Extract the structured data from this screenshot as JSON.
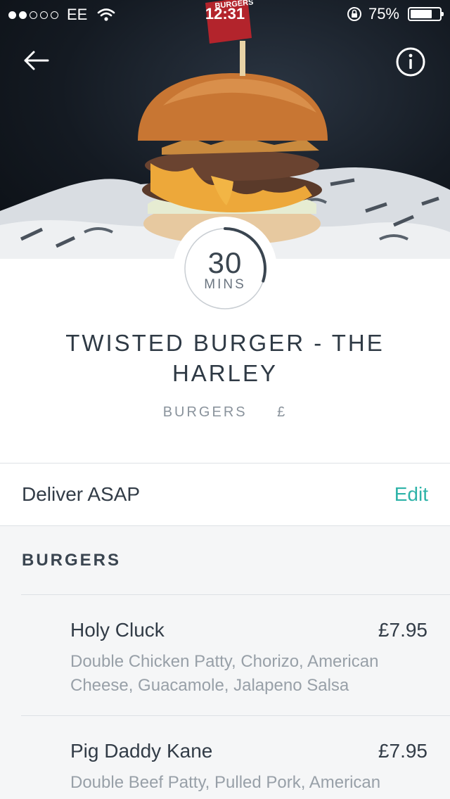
{
  "status_bar": {
    "carrier": "EE",
    "time": "12:31",
    "battery_text": "75%",
    "battery_level": 0.75,
    "signal_bars_filled": 2,
    "signal_bars_total": 5
  },
  "hero": {
    "image": "burger-photo",
    "flag_text": "BURGERS",
    "back_icon": "arrow-left-icon",
    "info_icon": "info-circle-icon"
  },
  "eta": {
    "value": "30",
    "unit": "MINS",
    "progress": 0.3
  },
  "restaurant": {
    "name": "TWISTED BURGER - THE HARLEY",
    "cuisine": "BURGERS",
    "price_level": "£"
  },
  "delivery": {
    "label": "Deliver ASAP",
    "edit_label": "Edit"
  },
  "menu": {
    "section_title": "BURGERS",
    "items": [
      {
        "name": "Holy Cluck",
        "price": "£7.95",
        "description": "Double Chicken Patty, Chorizo, American Cheese, Guacamole, Jalapeno Salsa"
      },
      {
        "name": "Pig Daddy Kane",
        "price": "£7.95",
        "description": "Double Beef Patty, Pulled Pork, American"
      }
    ]
  },
  "colors": {
    "accent": "#2eb3a8",
    "text_dark": "#323c47",
    "text_muted": "#98a0a8",
    "background": "#f5f6f7"
  }
}
